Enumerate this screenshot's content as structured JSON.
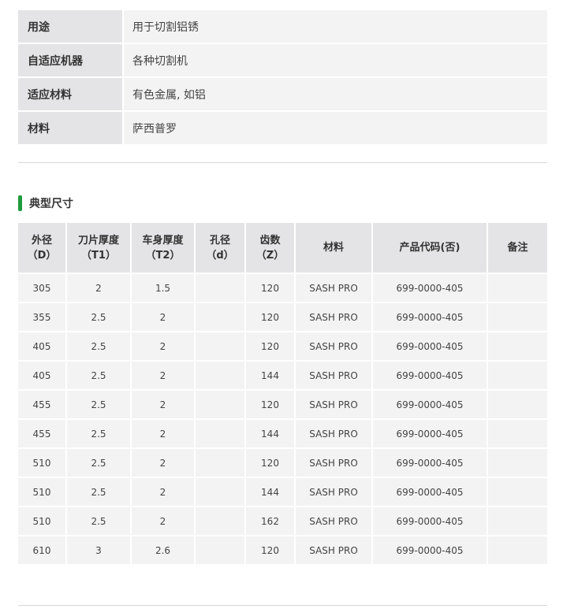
{
  "specs": [
    {
      "label": "用途",
      "value": "用于切割铝锈"
    },
    {
      "label": "自适应机器",
      "value": "各种切割机"
    },
    {
      "label": "适应材料",
      "value": "有色金属, 如铝"
    },
    {
      "label": "材料",
      "value": "萨西普罗"
    }
  ],
  "section": {
    "title": "典型尺寸"
  },
  "table": {
    "headers": [
      "外径\n（D）",
      "刀片厚度\n（T1）",
      "车身厚度\n（T2）",
      "孔径\n（d）",
      "齿数\n（Z）",
      "材料",
      "产品代码(否)",
      "备注"
    ],
    "rows": [
      [
        "305",
        "2",
        "1.5",
        "",
        "120",
        "SASH PRO",
        "699-0000-405",
        ""
      ],
      [
        "355",
        "2.5",
        "2",
        "",
        "120",
        "SASH PRO",
        "699-0000-405",
        ""
      ],
      [
        "405",
        "2.5",
        "2",
        "",
        "120",
        "SASH PRO",
        "699-0000-405",
        ""
      ],
      [
        "405",
        "2.5",
        "2",
        "",
        "144",
        "SASH PRO",
        "699-0000-405",
        ""
      ],
      [
        "455",
        "2.5",
        "2",
        "",
        "120",
        "SASH PRO",
        "699-0000-405",
        ""
      ],
      [
        "455",
        "2.5",
        "2",
        "",
        "144",
        "SASH PRO",
        "699-0000-405",
        ""
      ],
      [
        "510",
        "2.5",
        "2",
        "",
        "120",
        "SASH PRO",
        "699-0000-405",
        ""
      ],
      [
        "510",
        "2.5",
        "2",
        "",
        "144",
        "SASH PRO",
        "699-0000-405",
        ""
      ],
      [
        "510",
        "2.5",
        "2",
        "",
        "162",
        "SASH PRO",
        "699-0000-405",
        ""
      ],
      [
        "610",
        "3",
        "2.6",
        "",
        "120",
        "SASH PRO",
        "699-0000-405",
        ""
      ]
    ]
  },
  "colors": {
    "accent_bar": "#1e9a3c",
    "header_bg": "#e4e4e6",
    "cell_bg": "#f3f3f4"
  }
}
